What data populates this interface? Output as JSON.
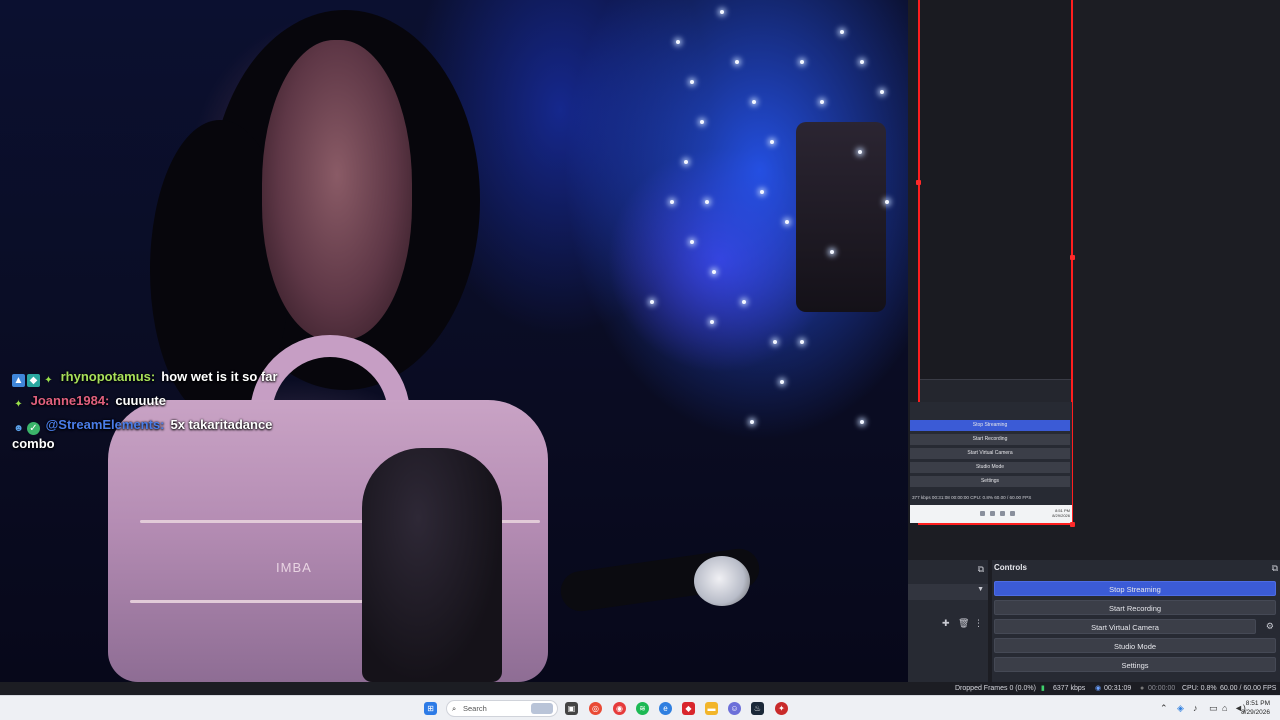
{
  "chat": [
    {
      "badges": [
        "photo-badge",
        "bits-badge",
        "sparkle-badge"
      ],
      "username": "rhynopotamus:",
      "username_color": "#a8e05a",
      "message": "how wet is it so far"
    },
    {
      "badges": [
        "sparkle-badge"
      ],
      "username": "Joanne1984:",
      "username_color": "#e0607e",
      "message": "cuuuute"
    },
    {
      "badges": [
        "robot-badge",
        "verified-badge"
      ],
      "username": "@StreamElements:",
      "username_color": "#4a7de8",
      "message": "5x takaritadance combo"
    }
  ],
  "webcam": {
    "bag_logo": "IMBA"
  },
  "nested_preview": {
    "buttons": [
      "Stop Streaming",
      "Start Recording",
      "Start Virtual Camera",
      "Studio Mode",
      "Settings"
    ],
    "status": "377 kbps   00:31:08   00:00:00   CPU: 0.8%   60.00 / 60.00 FPS",
    "clock_time": "8:51 PM",
    "clock_date": "8/29/2026"
  },
  "controls": {
    "title": "Controls",
    "stop_streaming": "Stop Streaming",
    "start_recording": "Start Recording",
    "start_virtual_camera": "Start Virtual Camera",
    "studio_mode": "Studio Mode",
    "settings": "Settings"
  },
  "status_bar": {
    "dropped_frames": "Dropped Frames 0 (0.0%)",
    "bitrate": "6377 kbps",
    "stream_time": "00:31:09",
    "record_time": "00:00:00",
    "cpu": "CPU: 0.8%",
    "fps": "60.00 / 60.00 FPS"
  },
  "taskbar": {
    "search_placeholder": "Search",
    "clock_time": "8:51 PM",
    "clock_date": "8/29/2026"
  },
  "colors": {
    "accent_blue": "#3b5bd6",
    "selection_red": "#ff1e1e",
    "panel_bg": "#272a33"
  }
}
